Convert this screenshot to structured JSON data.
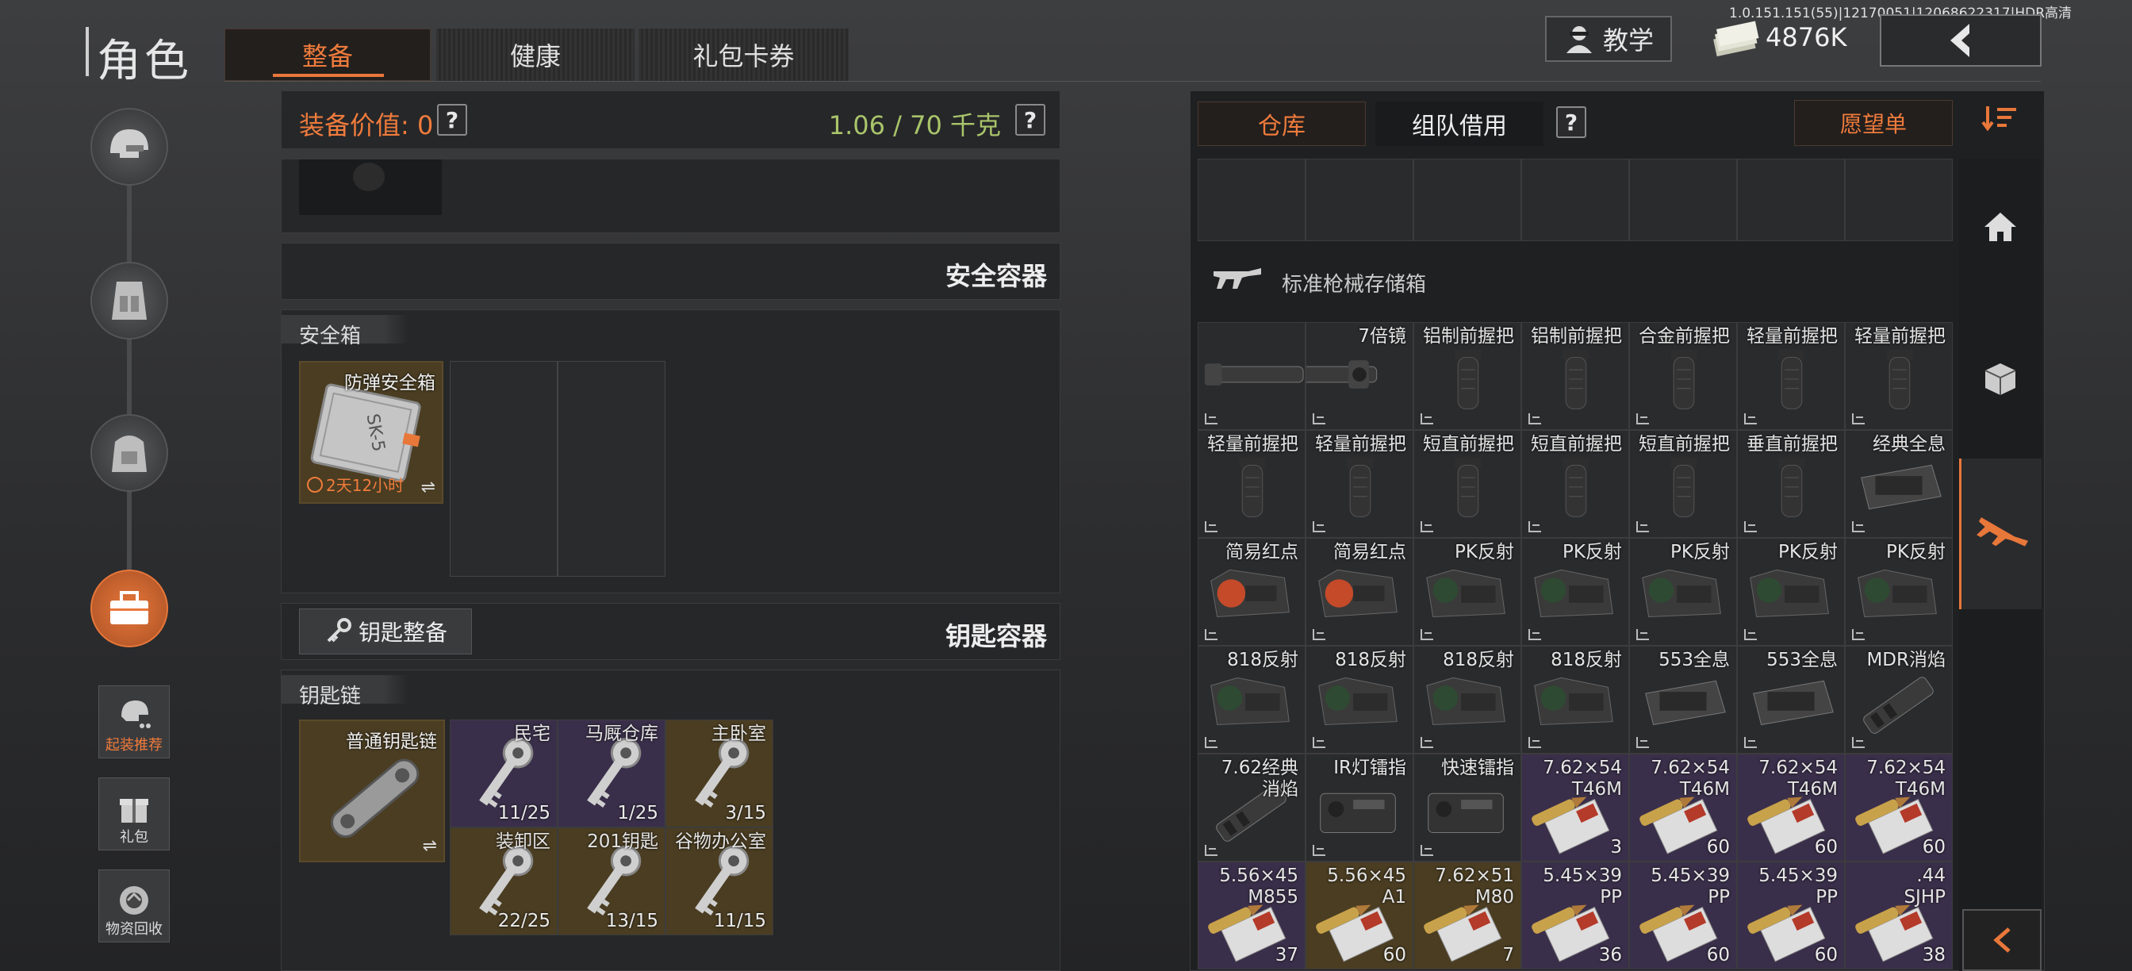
{
  "version": "1.0.151.151(55)|12170051|12068622317|HDR高清",
  "header": {
    "title": "角色",
    "tabs": [
      "整备",
      "健康",
      "礼包卡券"
    ],
    "tutorial_label": "教学",
    "currency": "4876K"
  },
  "sidebar": {
    "items": [
      "helmet",
      "backpack",
      "rig",
      "toolbox"
    ],
    "extra": [
      "起装推荐",
      "礼包",
      "物资回收"
    ]
  },
  "left": {
    "equip_value_label": "装备价值: 0",
    "weight": "1.06 / 70 千克",
    "secure_container_title": "安全容器",
    "safe_box_label": "安全箱",
    "safe_box_item": "防弹安全箱",
    "safe_box_timer": "2天12小时",
    "safe_box_code": "SK-5",
    "key_equip_button": "钥匙整备",
    "key_container_title": "钥匙容器",
    "keychain_label": "钥匙链",
    "keychain_item": "普通钥匙链",
    "keys": [
      {
        "name": "民宅",
        "count": "11/25"
      },
      {
        "name": "马厩仓库",
        "count": "1/25"
      },
      {
        "name": "主卧室",
        "count": "3/15"
      },
      {
        "name": "装卸区",
        "count": "22/25"
      },
      {
        "name": "201钥匙",
        "count": "13/15"
      },
      {
        "name": "谷物办公室",
        "count": "11/15"
      }
    ]
  },
  "right": {
    "tabs": [
      "仓库",
      "组队借用"
    ],
    "wishlist": "愿望单",
    "storage_title": "标准枪械存储箱",
    "items": [
      {
        "name": "",
        "count": "",
        "kind": "scope"
      },
      {
        "name": "7倍镜",
        "count": "",
        "kind": "scope2"
      },
      {
        "name": "铝制前握把",
        "count": "",
        "kind": "grip"
      },
      {
        "name": "铝制前握把",
        "count": "",
        "kind": "grip"
      },
      {
        "name": "合金前握把",
        "count": "",
        "kind": "grip"
      },
      {
        "name": "轻量前握把",
        "count": "",
        "kind": "grip"
      },
      {
        "name": "轻量前握把",
        "count": "",
        "kind": "grip"
      },
      {
        "name": "轻量前握把",
        "count": "",
        "kind": "grip"
      },
      {
        "name": "轻量前握把",
        "count": "",
        "kind": "grip"
      },
      {
        "name": "短直前握把",
        "count": "",
        "kind": "grip"
      },
      {
        "name": "短直前握把",
        "count": "",
        "kind": "grip"
      },
      {
        "name": "短直前握把",
        "count": "",
        "kind": "grip"
      },
      {
        "name": "垂直前握把",
        "count": "",
        "kind": "grip"
      },
      {
        "name": "经典全息",
        "count": "",
        "kind": "holo"
      },
      {
        "name": "简易红点",
        "count": "",
        "kind": "red"
      },
      {
        "name": "简易红点",
        "count": "",
        "kind": "red"
      },
      {
        "name": "PK反射",
        "count": "",
        "kind": "sight"
      },
      {
        "name": "PK反射",
        "count": "",
        "kind": "sight"
      },
      {
        "name": "PK反射",
        "count": "",
        "kind": "sight"
      },
      {
        "name": "PK反射",
        "count": "",
        "kind": "sight"
      },
      {
        "name": "PK反射",
        "count": "",
        "kind": "sight"
      },
      {
        "name": "818反射",
        "count": "",
        "kind": "sight"
      },
      {
        "name": "818反射",
        "count": "",
        "kind": "sight"
      },
      {
        "name": "818反射",
        "count": "",
        "kind": "sight"
      },
      {
        "name": "818反射",
        "count": "",
        "kind": "sight"
      },
      {
        "name": "553全息",
        "count": "",
        "kind": "holo"
      },
      {
        "name": "553全息",
        "count": "",
        "kind": "holo"
      },
      {
        "name": "MDR消焰",
        "count": "",
        "kind": "muzzle"
      },
      {
        "name": "7.62经典\n消焰",
        "count": "",
        "kind": "muzzle"
      },
      {
        "name": "IR灯镭指",
        "count": "",
        "kind": "laser"
      },
      {
        "name": "快速镭指",
        "count": "",
        "kind": "laser"
      },
      {
        "name": "7.62×54\nT46M",
        "count": "3",
        "kind": "ammo"
      },
      {
        "name": "7.62×54\nT46M",
        "count": "60",
        "kind": "ammo"
      },
      {
        "name": "7.62×54\nT46M",
        "count": "60",
        "kind": "ammo"
      },
      {
        "name": "7.62×54\nT46M",
        "count": "60",
        "kind": "ammo"
      },
      {
        "name": "5.56×45\nM855",
        "count": "37",
        "kind": "ammo"
      },
      {
        "name": "5.56×45\nA1",
        "count": "60",
        "kind": "ammo2"
      },
      {
        "name": "7.62×51\nM80",
        "count": "7",
        "kind": "ammo2"
      },
      {
        "name": "5.45×39\nPP",
        "count": "36",
        "kind": "ammo"
      },
      {
        "name": "5.45×39\nPP",
        "count": "60",
        "kind": "ammo"
      },
      {
        "name": "5.45×39\nPP",
        "count": "60",
        "kind": "ammo"
      },
      {
        "name": ".44\nSJHP",
        "count": "38",
        "kind": "ammo"
      }
    ]
  },
  "colors": {
    "accent": "#e8773a",
    "weight": "#a9c46a",
    "panel": "#262729"
  }
}
